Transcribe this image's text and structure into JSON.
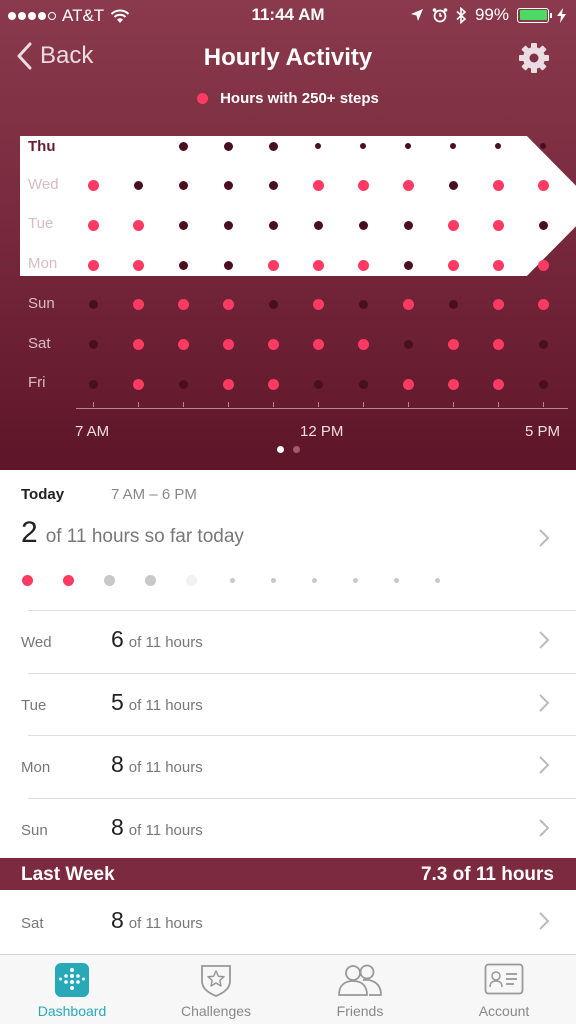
{
  "status_bar": {
    "carrier": "AT&T",
    "time": "11:44 AM",
    "battery": "99%",
    "signal_strength": 4,
    "battery_color": "#4cd964"
  },
  "nav": {
    "back_label": "Back",
    "title": "Hourly Activity"
  },
  "legend": {
    "label": "Hours with 250+ steps",
    "color": "#ff3b63"
  },
  "chart": {
    "hour_labels": [
      "7 AM",
      "12 PM",
      "5 PM"
    ],
    "rows": [
      {
        "day": "Thu",
        "today": true,
        "states": [
          "w",
          "w",
          "d",
          "d",
          "d",
          "s",
          "s",
          "s",
          "s",
          "s",
          "s"
        ]
      },
      {
        "day": "Wed",
        "today": false,
        "states": [
          "r",
          "d",
          "d",
          "d",
          "d",
          "r",
          "r",
          "r",
          "d",
          "r",
          "r"
        ]
      },
      {
        "day": "Tue",
        "today": false,
        "states": [
          "r",
          "r",
          "d",
          "d",
          "d",
          "d",
          "d",
          "d",
          "r",
          "r",
          "d"
        ]
      },
      {
        "day": "Mon",
        "today": false,
        "states": [
          "r",
          "r",
          "d",
          "d",
          "r",
          "r",
          "r",
          "d",
          "r",
          "r",
          "r"
        ]
      },
      {
        "day": "Sun",
        "today": false,
        "states": [
          "d",
          "r",
          "r",
          "r",
          "d",
          "r",
          "d",
          "r",
          "d",
          "r",
          "r"
        ]
      },
      {
        "day": "Sat",
        "today": false,
        "states": [
          "d",
          "r",
          "r",
          "r",
          "r",
          "r",
          "r",
          "d",
          "r",
          "r",
          "d"
        ]
      },
      {
        "day": "Fri",
        "today": false,
        "states": [
          "d",
          "r",
          "d",
          "r",
          "r",
          "d",
          "d",
          "r",
          "r",
          "r",
          "d"
        ]
      }
    ]
  },
  "pager": {
    "pages": 2,
    "active": 0
  },
  "today": {
    "label": "Today",
    "range": "7 AM – 6 PM",
    "count": "2",
    "summary_text": "of 11 hours so far today",
    "hour_states": [
      "active",
      "active",
      "past",
      "past",
      "current",
      "future",
      "future",
      "future",
      "future",
      "future",
      "future"
    ]
  },
  "days": [
    {
      "day": "Wed",
      "count": "6",
      "of_text": "of 11 hours"
    },
    {
      "day": "Tue",
      "count": "5",
      "of_text": "of 11 hours"
    },
    {
      "day": "Mon",
      "count": "8",
      "of_text": "of 11 hours"
    },
    {
      "day": "Sun",
      "count": "8",
      "of_text": "of 11 hours"
    }
  ],
  "last_week": {
    "title": "Last Week",
    "value": "7.3 of 11 hours"
  },
  "last_week_days": [
    {
      "day": "Sat",
      "count": "8",
      "of_text": "of 11 hours"
    }
  ],
  "tabs": [
    {
      "label": "Dashboard",
      "icon": "dashboard-icon",
      "active": true
    },
    {
      "label": "Challenges",
      "icon": "challenges-icon",
      "active": false
    },
    {
      "label": "Friends",
      "icon": "friends-icon",
      "active": false
    },
    {
      "label": "Account",
      "icon": "account-icon",
      "active": false
    }
  ],
  "colors": {
    "hero": "#7a2a3e",
    "active_dot": "#ff3b63",
    "accent": "#27a9b8"
  }
}
